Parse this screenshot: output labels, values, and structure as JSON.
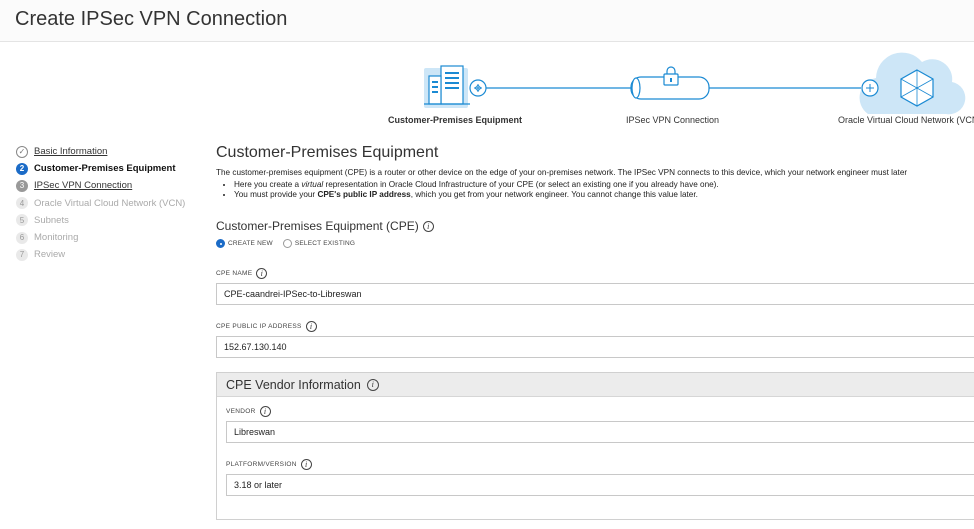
{
  "page": {
    "title": "Create IPSec VPN Connection"
  },
  "diagram": {
    "cpe_label": "Customer-Premises Equipment",
    "ipsec_label": "IPSec VPN Connection",
    "vcn_label": "Oracle Virtual Cloud Network (VCN)",
    "accent_color": "#1b8ad3"
  },
  "steps": [
    {
      "num": "✓",
      "label": "Basic Information",
      "state": "done"
    },
    {
      "num": "2",
      "label": "Customer-Premises Equipment",
      "state": "current"
    },
    {
      "num": "3",
      "label": "IPSec VPN Connection",
      "state": "next"
    },
    {
      "num": "4",
      "label": "Oracle Virtual Cloud Network (VCN)",
      "state": "disabled"
    },
    {
      "num": "5",
      "label": "Subnets",
      "state": "disabled"
    },
    {
      "num": "6",
      "label": "Monitoring",
      "state": "disabled"
    },
    {
      "num": "7",
      "label": "Review",
      "state": "disabled"
    }
  ],
  "section": {
    "title": "Customer-Premises Equipment",
    "intro": "The customer-premises equipment (CPE) is a router or other device on the edge of your on-premises network. The IPSec VPN connects to this device, which your network engineer must later",
    "bullet1_a": "Here you create a ",
    "bullet1_em": "virtual",
    "bullet1_b": " representation in Oracle Cloud Infrastructure of your CPE (or select an existing one if you already have one).",
    "bullet2_a": "You must provide your ",
    "bullet2_strong": "CPE's public IP address",
    "bullet2_b": ", which you get from your network engineer. You cannot change this value later."
  },
  "cpe": {
    "heading": "Customer-Premises Equipment (CPE)",
    "radio_create": "CREATE NEW",
    "radio_select": "SELECT EXISTING",
    "name_label": "CPE NAME",
    "name_value": "CPE-caandrei-IPSec-to-Libreswan",
    "ip_label": "CPE PUBLIC IP ADDRESS",
    "ip_value": "152.67.130.140"
  },
  "vendor": {
    "heading": "CPE Vendor Information",
    "vendor_label": "VENDOR",
    "vendor_value": "Libreswan",
    "platform_label": "PLATFORM/VERSION",
    "platform_value": "3.18 or later"
  },
  "info_glyph": "i"
}
